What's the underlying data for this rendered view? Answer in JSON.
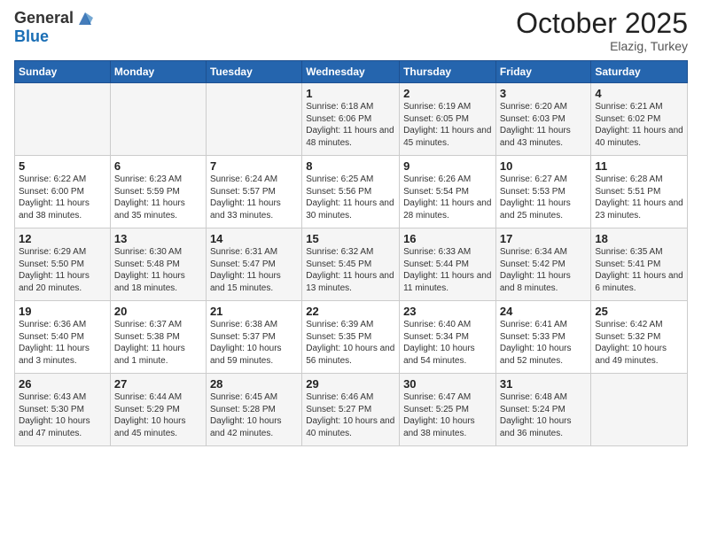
{
  "header": {
    "logo_general": "General",
    "logo_blue": "Blue",
    "month": "October 2025",
    "location": "Elazig, Turkey"
  },
  "weekdays": [
    "Sunday",
    "Monday",
    "Tuesday",
    "Wednesday",
    "Thursday",
    "Friday",
    "Saturday"
  ],
  "weeks": [
    [
      {
        "day": "",
        "info": ""
      },
      {
        "day": "",
        "info": ""
      },
      {
        "day": "",
        "info": ""
      },
      {
        "day": "1",
        "info": "Sunrise: 6:18 AM\nSunset: 6:06 PM\nDaylight: 11 hours and 48 minutes."
      },
      {
        "day": "2",
        "info": "Sunrise: 6:19 AM\nSunset: 6:05 PM\nDaylight: 11 hours and 45 minutes."
      },
      {
        "day": "3",
        "info": "Sunrise: 6:20 AM\nSunset: 6:03 PM\nDaylight: 11 hours and 43 minutes."
      },
      {
        "day": "4",
        "info": "Sunrise: 6:21 AM\nSunset: 6:02 PM\nDaylight: 11 hours and 40 minutes."
      }
    ],
    [
      {
        "day": "5",
        "info": "Sunrise: 6:22 AM\nSunset: 6:00 PM\nDaylight: 11 hours and 38 minutes."
      },
      {
        "day": "6",
        "info": "Sunrise: 6:23 AM\nSunset: 5:59 PM\nDaylight: 11 hours and 35 minutes."
      },
      {
        "day": "7",
        "info": "Sunrise: 6:24 AM\nSunset: 5:57 PM\nDaylight: 11 hours and 33 minutes."
      },
      {
        "day": "8",
        "info": "Sunrise: 6:25 AM\nSunset: 5:56 PM\nDaylight: 11 hours and 30 minutes."
      },
      {
        "day": "9",
        "info": "Sunrise: 6:26 AM\nSunset: 5:54 PM\nDaylight: 11 hours and 28 minutes."
      },
      {
        "day": "10",
        "info": "Sunrise: 6:27 AM\nSunset: 5:53 PM\nDaylight: 11 hours and 25 minutes."
      },
      {
        "day": "11",
        "info": "Sunrise: 6:28 AM\nSunset: 5:51 PM\nDaylight: 11 hours and 23 minutes."
      }
    ],
    [
      {
        "day": "12",
        "info": "Sunrise: 6:29 AM\nSunset: 5:50 PM\nDaylight: 11 hours and 20 minutes."
      },
      {
        "day": "13",
        "info": "Sunrise: 6:30 AM\nSunset: 5:48 PM\nDaylight: 11 hours and 18 minutes."
      },
      {
        "day": "14",
        "info": "Sunrise: 6:31 AM\nSunset: 5:47 PM\nDaylight: 11 hours and 15 minutes."
      },
      {
        "day": "15",
        "info": "Sunrise: 6:32 AM\nSunset: 5:45 PM\nDaylight: 11 hours and 13 minutes."
      },
      {
        "day": "16",
        "info": "Sunrise: 6:33 AM\nSunset: 5:44 PM\nDaylight: 11 hours and 11 minutes."
      },
      {
        "day": "17",
        "info": "Sunrise: 6:34 AM\nSunset: 5:42 PM\nDaylight: 11 hours and 8 minutes."
      },
      {
        "day": "18",
        "info": "Sunrise: 6:35 AM\nSunset: 5:41 PM\nDaylight: 11 hours and 6 minutes."
      }
    ],
    [
      {
        "day": "19",
        "info": "Sunrise: 6:36 AM\nSunset: 5:40 PM\nDaylight: 11 hours and 3 minutes."
      },
      {
        "day": "20",
        "info": "Sunrise: 6:37 AM\nSunset: 5:38 PM\nDaylight: 11 hours and 1 minute."
      },
      {
        "day": "21",
        "info": "Sunrise: 6:38 AM\nSunset: 5:37 PM\nDaylight: 10 hours and 59 minutes."
      },
      {
        "day": "22",
        "info": "Sunrise: 6:39 AM\nSunset: 5:35 PM\nDaylight: 10 hours and 56 minutes."
      },
      {
        "day": "23",
        "info": "Sunrise: 6:40 AM\nSunset: 5:34 PM\nDaylight: 10 hours and 54 minutes."
      },
      {
        "day": "24",
        "info": "Sunrise: 6:41 AM\nSunset: 5:33 PM\nDaylight: 10 hours and 52 minutes."
      },
      {
        "day": "25",
        "info": "Sunrise: 6:42 AM\nSunset: 5:32 PM\nDaylight: 10 hours and 49 minutes."
      }
    ],
    [
      {
        "day": "26",
        "info": "Sunrise: 6:43 AM\nSunset: 5:30 PM\nDaylight: 10 hours and 47 minutes."
      },
      {
        "day": "27",
        "info": "Sunrise: 6:44 AM\nSunset: 5:29 PM\nDaylight: 10 hours and 45 minutes."
      },
      {
        "day": "28",
        "info": "Sunrise: 6:45 AM\nSunset: 5:28 PM\nDaylight: 10 hours and 42 minutes."
      },
      {
        "day": "29",
        "info": "Sunrise: 6:46 AM\nSunset: 5:27 PM\nDaylight: 10 hours and 40 minutes."
      },
      {
        "day": "30",
        "info": "Sunrise: 6:47 AM\nSunset: 5:25 PM\nDaylight: 10 hours and 38 minutes."
      },
      {
        "day": "31",
        "info": "Sunrise: 6:48 AM\nSunset: 5:24 PM\nDaylight: 10 hours and 36 minutes."
      },
      {
        "day": "",
        "info": ""
      }
    ]
  ]
}
